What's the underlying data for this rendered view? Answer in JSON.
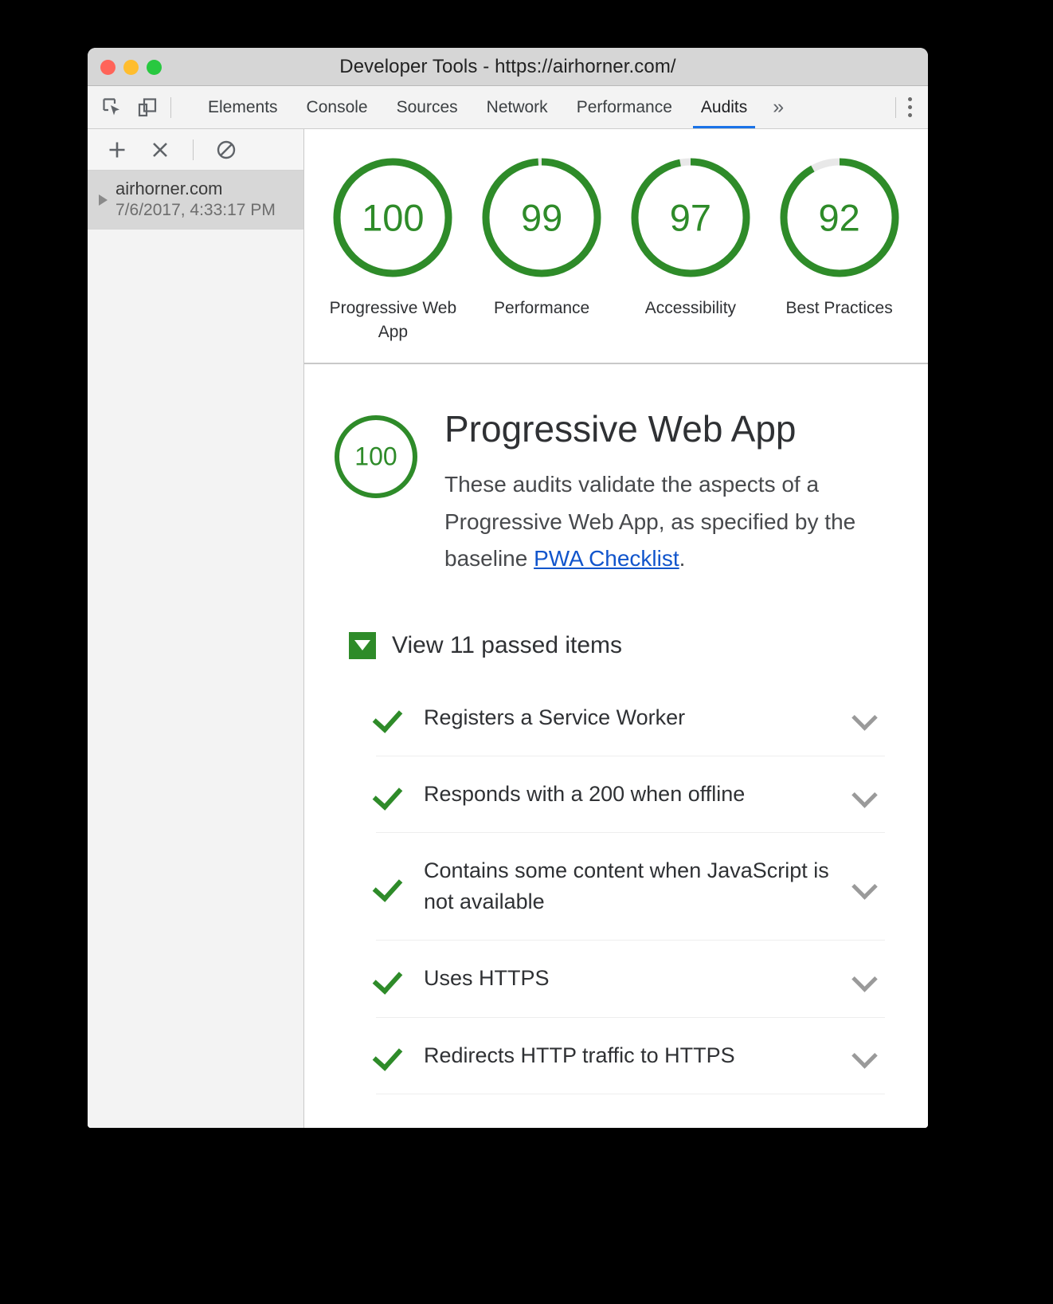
{
  "window": {
    "title": "Developer Tools - https://airhorner.com/",
    "traffic_lights": [
      "close",
      "minimize",
      "maximize"
    ]
  },
  "toolbar": {
    "inspect_icon": "inspect-cursor-icon",
    "device_icon": "device-toolbar-icon",
    "more_tabs_label": "»",
    "kebab_icon": "more-options-icon"
  },
  "tabs": [
    {
      "label": "Elements",
      "active": false
    },
    {
      "label": "Console",
      "active": false
    },
    {
      "label": "Sources",
      "active": false
    },
    {
      "label": "Network",
      "active": false
    },
    {
      "label": "Performance",
      "active": false
    },
    {
      "label": "Audits",
      "active": true
    }
  ],
  "sidebar": {
    "buttons": [
      {
        "name": "add-audit-button",
        "icon": "plus-icon",
        "label": "+"
      },
      {
        "name": "delete-audit-button",
        "icon": "close-icon",
        "label": "×"
      },
      {
        "name": "clear-all-button",
        "icon": "no-entry-icon",
        "label": "⊘"
      }
    ],
    "items": [
      {
        "host": "airhorner.com",
        "timestamp": "7/6/2017, 4:33:17 PM",
        "selected": true
      }
    ]
  },
  "colors": {
    "pass_green": "#2e8b29",
    "gauge_track": "#e8e8e8",
    "link_blue": "#1155cc",
    "active_tab_underline": "#1a73e8",
    "traffic_red": "#ff6459",
    "traffic_yellow": "#ffbd2e",
    "traffic_green": "#28c840"
  },
  "chart_data": {
    "type": "gauge",
    "title": "Lighthouse audit scores",
    "categories": [
      "Progressive Web App",
      "Performance",
      "Accessibility",
      "Best Practices"
    ],
    "values": [
      100,
      99,
      97,
      92
    ],
    "ylim": [
      0,
      100
    ],
    "unit": "score",
    "legend": "none"
  },
  "gauges": [
    {
      "score": "100",
      "value": 100,
      "label": "Progressive Web App"
    },
    {
      "score": "99",
      "value": 99,
      "label": "Performance"
    },
    {
      "score": "97",
      "value": 97,
      "label": "Accessibility"
    },
    {
      "score": "92",
      "value": 92,
      "label": "Best Practices"
    }
  ],
  "detail": {
    "score": "100",
    "value": 100,
    "title": "Progressive Web App",
    "description_before": "These audits validate the aspects of a Progressive Web App, as specified by the baseline ",
    "link_text": "PWA Checklist",
    "description_after": "."
  },
  "passed": {
    "toggle_label": "View 11 passed items",
    "count": 11,
    "expanded": true,
    "items": [
      {
        "label": "Registers a Service Worker",
        "status": "pass"
      },
      {
        "label": "Responds with a 200 when offline",
        "status": "pass"
      },
      {
        "label": "Contains some content when JavaScript is not available",
        "status": "pass"
      },
      {
        "label": "Uses HTTPS",
        "status": "pass"
      },
      {
        "label": "Redirects HTTP traffic to HTTPS",
        "status": "pass"
      }
    ]
  }
}
